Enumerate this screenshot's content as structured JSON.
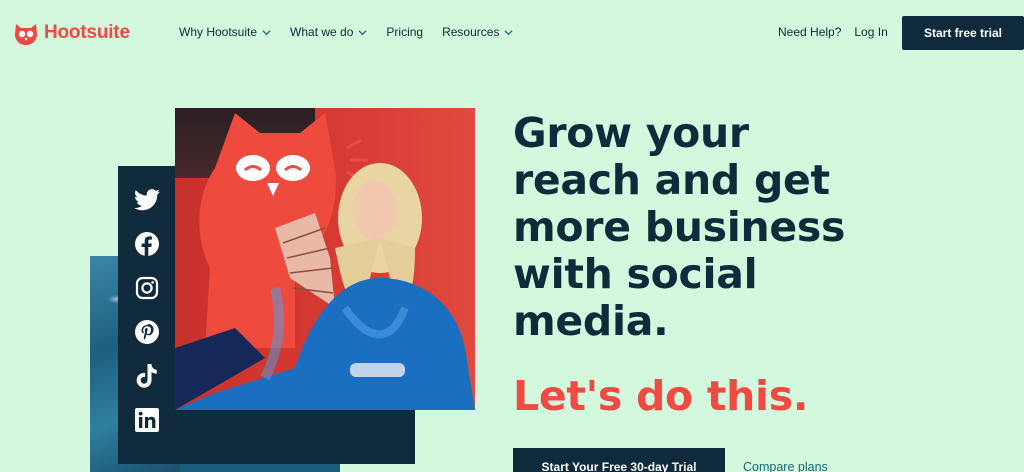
{
  "brand": {
    "name": "Hootsuite",
    "color": "#f04a42"
  },
  "nav": {
    "items": [
      {
        "label": "Why Hootsuite",
        "has_dropdown": true
      },
      {
        "label": "What we do",
        "has_dropdown": true
      },
      {
        "label": "Pricing",
        "has_dropdown": false
      },
      {
        "label": "Resources",
        "has_dropdown": true
      }
    ],
    "help": "Need Help?",
    "login": "Log In",
    "cta": "Start free trial"
  },
  "hero": {
    "headline_lines": [
      "Grow your",
      "reach and get",
      "more business",
      "with social",
      "media."
    ],
    "headline_accent": "Let's do this.",
    "cta": "Start Your Free 30-day Trial",
    "secondary_link": "Compare plans"
  },
  "social_icons": [
    "twitter-icon",
    "facebook-icon",
    "instagram-icon",
    "pinterest-icon",
    "tiktok-icon",
    "linkedin-icon"
  ],
  "colors": {
    "background": "#d4f8dd",
    "navy": "#0f2a3a",
    "red": "#f04a42",
    "teal_link": "#176a72"
  }
}
